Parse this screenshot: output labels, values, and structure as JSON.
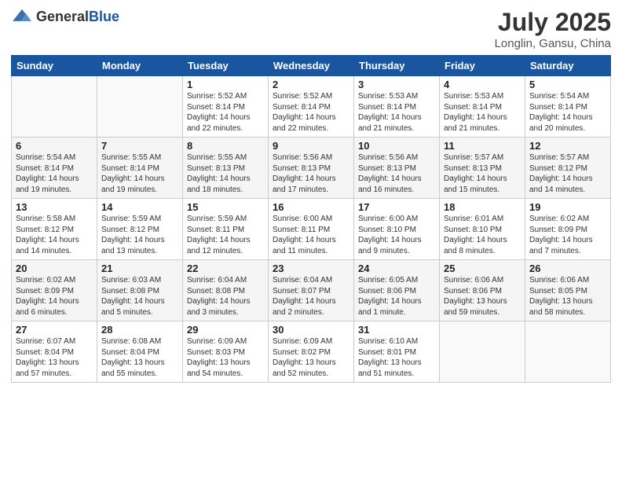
{
  "header": {
    "logo_general": "General",
    "logo_blue": "Blue",
    "month_year": "July 2025",
    "location": "Longlin, Gansu, China"
  },
  "weekdays": [
    "Sunday",
    "Monday",
    "Tuesday",
    "Wednesday",
    "Thursday",
    "Friday",
    "Saturday"
  ],
  "weeks": [
    [
      {
        "day": "",
        "info": ""
      },
      {
        "day": "",
        "info": ""
      },
      {
        "day": "1",
        "info": "Sunrise: 5:52 AM\nSunset: 8:14 PM\nDaylight: 14 hours\nand 22 minutes."
      },
      {
        "day": "2",
        "info": "Sunrise: 5:52 AM\nSunset: 8:14 PM\nDaylight: 14 hours\nand 22 minutes."
      },
      {
        "day": "3",
        "info": "Sunrise: 5:53 AM\nSunset: 8:14 PM\nDaylight: 14 hours\nand 21 minutes."
      },
      {
        "day": "4",
        "info": "Sunrise: 5:53 AM\nSunset: 8:14 PM\nDaylight: 14 hours\nand 21 minutes."
      },
      {
        "day": "5",
        "info": "Sunrise: 5:54 AM\nSunset: 8:14 PM\nDaylight: 14 hours\nand 20 minutes."
      }
    ],
    [
      {
        "day": "6",
        "info": "Sunrise: 5:54 AM\nSunset: 8:14 PM\nDaylight: 14 hours\nand 19 minutes."
      },
      {
        "day": "7",
        "info": "Sunrise: 5:55 AM\nSunset: 8:14 PM\nDaylight: 14 hours\nand 19 minutes."
      },
      {
        "day": "8",
        "info": "Sunrise: 5:55 AM\nSunset: 8:13 PM\nDaylight: 14 hours\nand 18 minutes."
      },
      {
        "day": "9",
        "info": "Sunrise: 5:56 AM\nSunset: 8:13 PM\nDaylight: 14 hours\nand 17 minutes."
      },
      {
        "day": "10",
        "info": "Sunrise: 5:56 AM\nSunset: 8:13 PM\nDaylight: 14 hours\nand 16 minutes."
      },
      {
        "day": "11",
        "info": "Sunrise: 5:57 AM\nSunset: 8:13 PM\nDaylight: 14 hours\nand 15 minutes."
      },
      {
        "day": "12",
        "info": "Sunrise: 5:57 AM\nSunset: 8:12 PM\nDaylight: 14 hours\nand 14 minutes."
      }
    ],
    [
      {
        "day": "13",
        "info": "Sunrise: 5:58 AM\nSunset: 8:12 PM\nDaylight: 14 hours\nand 14 minutes."
      },
      {
        "day": "14",
        "info": "Sunrise: 5:59 AM\nSunset: 8:12 PM\nDaylight: 14 hours\nand 13 minutes."
      },
      {
        "day": "15",
        "info": "Sunrise: 5:59 AM\nSunset: 8:11 PM\nDaylight: 14 hours\nand 12 minutes."
      },
      {
        "day": "16",
        "info": "Sunrise: 6:00 AM\nSunset: 8:11 PM\nDaylight: 14 hours\nand 11 minutes."
      },
      {
        "day": "17",
        "info": "Sunrise: 6:00 AM\nSunset: 8:10 PM\nDaylight: 14 hours\nand 9 minutes."
      },
      {
        "day": "18",
        "info": "Sunrise: 6:01 AM\nSunset: 8:10 PM\nDaylight: 14 hours\nand 8 minutes."
      },
      {
        "day": "19",
        "info": "Sunrise: 6:02 AM\nSunset: 8:09 PM\nDaylight: 14 hours\nand 7 minutes."
      }
    ],
    [
      {
        "day": "20",
        "info": "Sunrise: 6:02 AM\nSunset: 8:09 PM\nDaylight: 14 hours\nand 6 minutes."
      },
      {
        "day": "21",
        "info": "Sunrise: 6:03 AM\nSunset: 8:08 PM\nDaylight: 14 hours\nand 5 minutes."
      },
      {
        "day": "22",
        "info": "Sunrise: 6:04 AM\nSunset: 8:08 PM\nDaylight: 14 hours\nand 3 minutes."
      },
      {
        "day": "23",
        "info": "Sunrise: 6:04 AM\nSunset: 8:07 PM\nDaylight: 14 hours\nand 2 minutes."
      },
      {
        "day": "24",
        "info": "Sunrise: 6:05 AM\nSunset: 8:06 PM\nDaylight: 14 hours\nand 1 minute."
      },
      {
        "day": "25",
        "info": "Sunrise: 6:06 AM\nSunset: 8:06 PM\nDaylight: 13 hours\nand 59 minutes."
      },
      {
        "day": "26",
        "info": "Sunrise: 6:06 AM\nSunset: 8:05 PM\nDaylight: 13 hours\nand 58 minutes."
      }
    ],
    [
      {
        "day": "27",
        "info": "Sunrise: 6:07 AM\nSunset: 8:04 PM\nDaylight: 13 hours\nand 57 minutes."
      },
      {
        "day": "28",
        "info": "Sunrise: 6:08 AM\nSunset: 8:04 PM\nDaylight: 13 hours\nand 55 minutes."
      },
      {
        "day": "29",
        "info": "Sunrise: 6:09 AM\nSunset: 8:03 PM\nDaylight: 13 hours\nand 54 minutes."
      },
      {
        "day": "30",
        "info": "Sunrise: 6:09 AM\nSunset: 8:02 PM\nDaylight: 13 hours\nand 52 minutes."
      },
      {
        "day": "31",
        "info": "Sunrise: 6:10 AM\nSunset: 8:01 PM\nDaylight: 13 hours\nand 51 minutes."
      },
      {
        "day": "",
        "info": ""
      },
      {
        "day": "",
        "info": ""
      }
    ]
  ]
}
